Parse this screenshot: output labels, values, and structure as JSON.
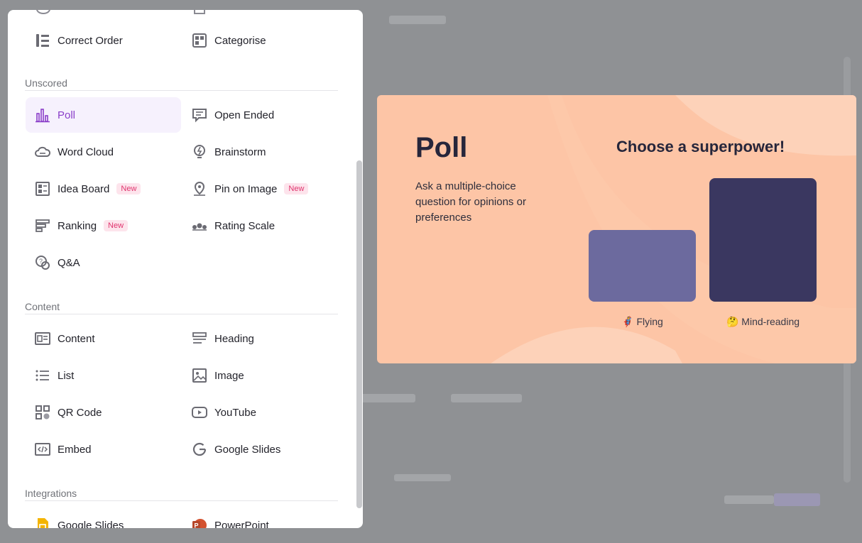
{
  "panel": {
    "top_row": [
      {
        "label": "Correct Order",
        "icon": "correct-order-icon"
      },
      {
        "label": "Categorise",
        "icon": "categorise-icon"
      }
    ],
    "sections": [
      {
        "title": "Unscored",
        "items": [
          {
            "label": "Poll",
            "icon": "poll-icon",
            "active": true
          },
          {
            "label": "Open Ended",
            "icon": "open-ended-icon"
          },
          {
            "label": "Word Cloud",
            "icon": "word-cloud-icon"
          },
          {
            "label": "Brainstorm",
            "icon": "brainstorm-icon"
          },
          {
            "label": "Idea Board",
            "icon": "idea-board-icon",
            "badge": "New"
          },
          {
            "label": "Pin on Image",
            "icon": "pin-icon",
            "badge": "New"
          },
          {
            "label": "Ranking",
            "icon": "ranking-icon",
            "badge": "New"
          },
          {
            "label": "Rating Scale",
            "icon": "rating-scale-icon"
          },
          {
            "label": "Q&A",
            "icon": "qa-icon"
          }
        ]
      },
      {
        "title": "Content",
        "items": [
          {
            "label": "Content",
            "icon": "content-icon"
          },
          {
            "label": "Heading",
            "icon": "heading-icon"
          },
          {
            "label": "List",
            "icon": "list-icon"
          },
          {
            "label": "Image",
            "icon": "image-icon"
          },
          {
            "label": "QR Code",
            "icon": "qr-code-icon"
          },
          {
            "label": "YouTube",
            "icon": "youtube-icon"
          },
          {
            "label": "Embed",
            "icon": "embed-icon"
          },
          {
            "label": "Google Slides",
            "icon": "google-icon"
          }
        ]
      },
      {
        "title": "Integrations",
        "items": [
          {
            "label": "Google Slides",
            "icon": "google-slides-icon"
          },
          {
            "label": "PowerPoint",
            "icon": "powerpoint-icon"
          }
        ]
      }
    ]
  },
  "preview": {
    "title": "Poll",
    "description": "Ask a multiple-choice question for opinions or preferences",
    "question": "Choose a superpower!",
    "options": [
      {
        "emoji": "🦸",
        "label": "Flying",
        "value": 0.58,
        "color": "#6c6a9e"
      },
      {
        "emoji": "🤔",
        "label": "Mind-reading",
        "value": 1.0,
        "color": "#3a3760"
      }
    ]
  },
  "colors": {
    "accent": "#8a3ec9",
    "badge": "#e0346e",
    "card_bg": "#fdc5a6"
  }
}
